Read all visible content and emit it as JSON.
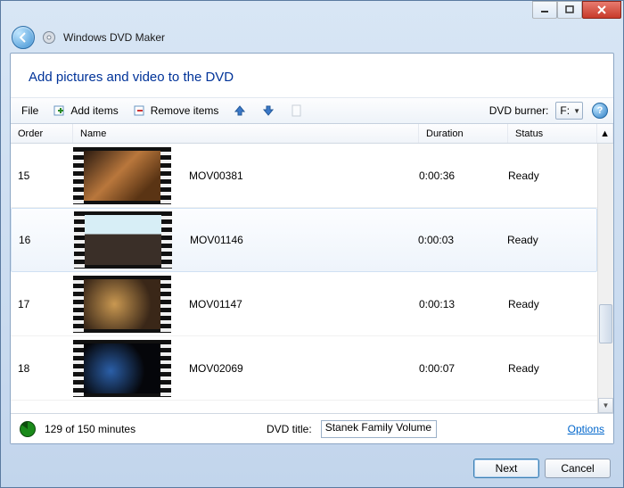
{
  "window": {
    "app_title": "Windows DVD Maker"
  },
  "heading": "Add pictures and video to the DVD",
  "toolbar": {
    "file": "File",
    "add": "Add items",
    "remove": "Remove items",
    "burner_label": "DVD burner:",
    "burner_value": "F:"
  },
  "columns": {
    "order": "Order",
    "name": "Name",
    "duration": "Duration",
    "status": "Status"
  },
  "items": [
    {
      "order": "15",
      "name": "MOV00381",
      "duration": "0:00:36",
      "status": "Ready",
      "frame": "linear-gradient(135deg,#2a1a10 0%,#b9773c 45%,#5a3414 80%)"
    },
    {
      "order": "16",
      "name": "MOV01146",
      "duration": "0:00:03",
      "status": "Ready",
      "frame": "linear-gradient(180deg,#d7eef6 0 38%,#3a2f28 38% 100%)"
    },
    {
      "order": "17",
      "name": "MOV01147",
      "duration": "0:00:13",
      "status": "Ready",
      "frame": "radial-gradient(circle at 40% 50%,#c99851,#3a2718 70%)"
    },
    {
      "order": "18",
      "name": "MOV02069",
      "duration": "0:00:07",
      "status": "Ready",
      "frame": "radial-gradient(circle at 35% 55%,#2b5fa8,#05060a 60%)"
    }
  ],
  "selected_index": 1,
  "bottom": {
    "minutes": "129 of 150 minutes",
    "title_label": "DVD title:",
    "title_value": "Stanek Family Volume",
    "options": "Options"
  },
  "footer": {
    "next": "Next",
    "cancel": "Cancel"
  }
}
